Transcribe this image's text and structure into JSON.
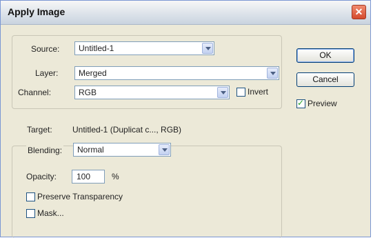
{
  "dialog": {
    "title": "Apply Image",
    "close_label": "✕"
  },
  "source": {
    "label": "Source:",
    "value": "Untitled-1"
  },
  "layer": {
    "label": "Layer:",
    "value": "Merged"
  },
  "channel": {
    "label": "Channel:",
    "value": "RGB",
    "invert_label": "Invert",
    "invert_checked": false
  },
  "target": {
    "label": "Target:",
    "value": "Untitled-1 (Duplicat c..., RGB)"
  },
  "blending": {
    "label": "Blending:",
    "value": "Normal"
  },
  "opacity": {
    "label": "Opacity:",
    "value": "100",
    "unit": "%"
  },
  "preserve_transparency": {
    "label": "Preserve Transparency",
    "checked": false
  },
  "mask": {
    "label": "Mask...",
    "checked": false
  },
  "buttons": {
    "ok": "OK",
    "cancel": "Cancel"
  },
  "preview": {
    "label": "Preview",
    "checked": true
  }
}
